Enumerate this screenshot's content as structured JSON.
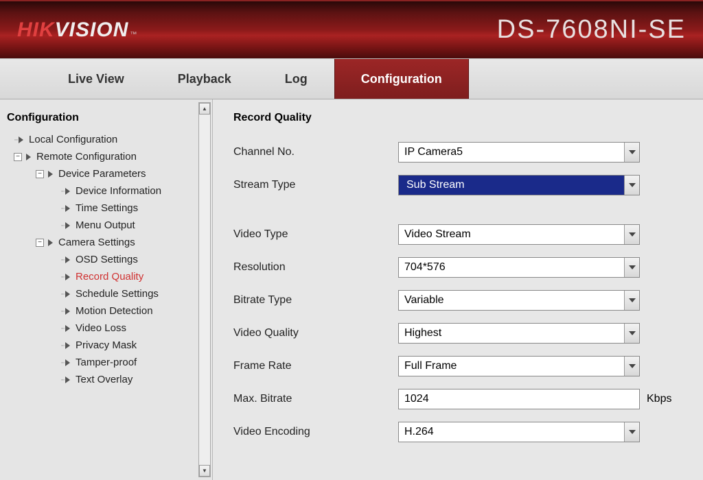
{
  "brand": {
    "part1": "HIK",
    "part2": "VISION",
    "tm": "™"
  },
  "model": "DS-7608NI-SE",
  "nav": {
    "live_view": "Live View",
    "playback": "Playback",
    "log": "Log",
    "configuration": "Configuration"
  },
  "sidebar": {
    "title": "Configuration",
    "items": {
      "local_config": "Local Configuration",
      "remote_config": "Remote Configuration",
      "device_params": "Device Parameters",
      "device_info": "Device Information",
      "time_settings": "Time Settings",
      "menu_output": "Menu Output",
      "camera_settings": "Camera Settings",
      "osd_settings": "OSD Settings",
      "record_quality": "Record Quality",
      "schedule_settings": "Schedule Settings",
      "motion_detection": "Motion Detection",
      "video_loss": "Video Loss",
      "privacy_mask": "Privacy Mask",
      "tamper_proof": "Tamper-proof",
      "text_overlay": "Text Overlay"
    }
  },
  "main": {
    "title": "Record Quality",
    "labels": {
      "channel_no": "Channel No.",
      "stream_type": "Stream Type",
      "video_type": "Video Type",
      "resolution": "Resolution",
      "bitrate_type": "Bitrate Type",
      "video_quality": "Video Quality",
      "frame_rate": "Frame Rate",
      "max_bitrate": "Max. Bitrate",
      "video_encoding": "Video Encoding"
    },
    "values": {
      "channel_no": "IP Camera5",
      "stream_type": "Sub Stream",
      "video_type": "Video Stream",
      "resolution": "704*576",
      "bitrate_type": "Variable",
      "video_quality": "Highest",
      "frame_rate": "Full Frame",
      "max_bitrate": "1024",
      "video_encoding": "H.264"
    },
    "units": {
      "kbps": "Kbps"
    }
  }
}
